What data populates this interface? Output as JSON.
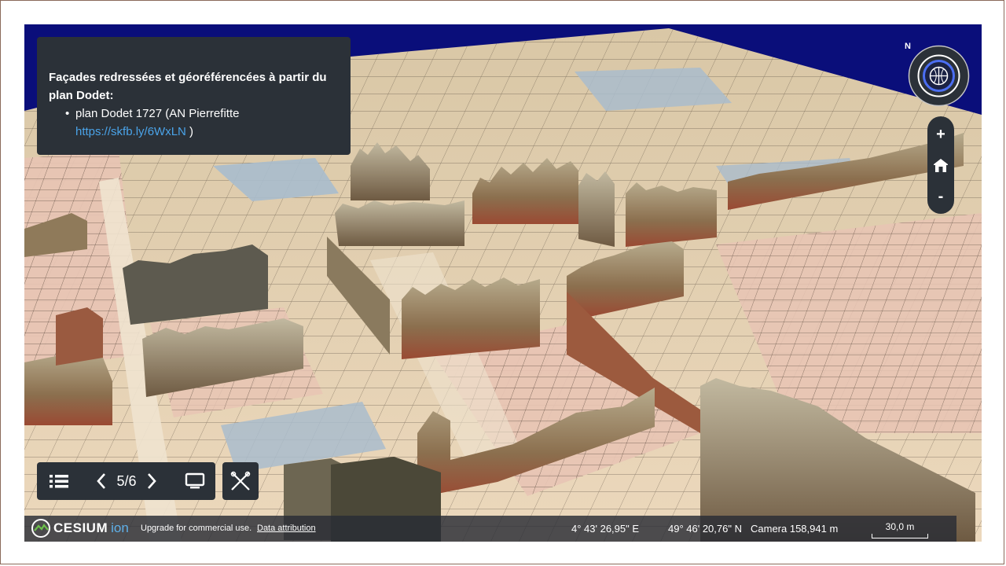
{
  "info_panel": {
    "title": "Façades redressées et géoréférencées à partir du plan Dodet:",
    "bullet_text": "plan Dodet 1727 (AN Pierrefitte",
    "link_text": "https://skfb.ly/6WxLN",
    "link_suffix": " )"
  },
  "navigation": {
    "menu_icon": "list-icon",
    "prev_icon": "chevron-left-icon",
    "page_indicator": "5/6",
    "next_icon": "chevron-right-icon",
    "screen_icon": "monitor-icon",
    "close_icon": "close-tools-icon"
  },
  "map_controls": {
    "compass_label": "N",
    "zoom_in": "+",
    "home_icon": "home-icon",
    "zoom_out": "-"
  },
  "status_bar": {
    "brand": "CESIUM",
    "brand_suffix": "ion",
    "upgrade_text": "Upgrade for commercial use.",
    "attribution_link": "Data attribution",
    "longitude": "4° 43' 26,95\" E",
    "latitude": "49° 46' 20,76\" N",
    "camera": "Camera 158,941 m",
    "scale_label": "30,0 m"
  },
  "colors": {
    "panel_bg": "#2b3138",
    "link": "#4aa3e8",
    "sky": "#0a0e7a",
    "map_paper": "#e8d4b4"
  }
}
